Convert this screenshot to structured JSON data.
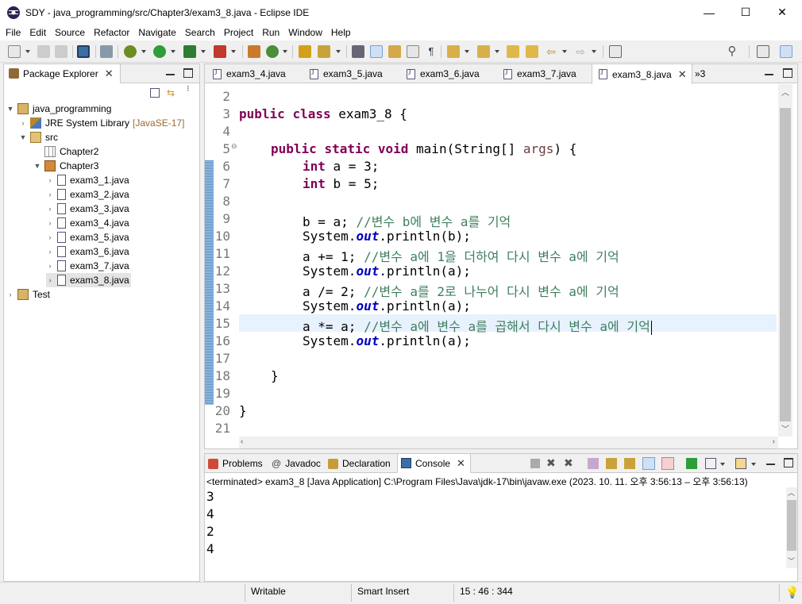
{
  "window": {
    "title": "SDY - java_programming/src/Chapter3/exam3_8.java - Eclipse IDE",
    "minimize": "—",
    "maximize": "☐",
    "close": "✕"
  },
  "menu": [
    "File",
    "Edit",
    "Source",
    "Refactor",
    "Navigate",
    "Search",
    "Project",
    "Run",
    "Window",
    "Help"
  ],
  "package_explorer": {
    "tab_label": "Package Explorer",
    "tree": {
      "project": "java_programming",
      "jre": "JRE System Library",
      "jre_decor": "[JavaSE-17]",
      "src": "src",
      "pkg_chapter2": "Chapter2",
      "pkg_chapter3": "Chapter3",
      "files": [
        "exam3_1.java",
        "exam3_2.java",
        "exam3_3.java",
        "exam3_4.java",
        "exam3_5.java",
        "exam3_6.java",
        "exam3_7.java",
        "exam3_8.java"
      ],
      "test_project": "Test"
    }
  },
  "editor": {
    "tabs": [
      "exam3_4.java",
      "exam3_5.java",
      "exam3_6.java",
      "exam3_7.java",
      "exam3_8.java"
    ],
    "active_tab": "exam3_8.java",
    "overflow": "»3",
    "line_numbers": [
      "2",
      "3",
      "4",
      "5",
      "6",
      "7",
      "8",
      "9",
      "10",
      "11",
      "12",
      "13",
      "14",
      "15",
      "16",
      "17",
      "18",
      "19",
      "20",
      "21"
    ],
    "code": {
      "l3a": "public",
      "l3b": " ",
      "l3c": "class",
      "l3d": " exam3_8 {",
      "l5a": "public",
      "l5b": "static",
      "l5c": "void",
      "l5d": " main(String[] ",
      "l5e": "args",
      "l5f": ") {",
      "l6a": "int",
      "l6b": " a = 3;",
      "l7a": "int",
      "l7b": " b = 5;",
      "l9a": "b = a; ",
      "l9b": "//변수 b에 변수 a를 기억",
      "sys": "System.",
      "out": "out",
      "println_b": ".println(b);",
      "println_a": ".println(a);",
      "l11a": "a += 1; ",
      "l11b": "//변수 a에 1을 더하여 다시 변수 a에 기억",
      "l13a": "a /= 2; ",
      "l13b": "//변수 a를 2로 나누어 다시 변수 a에 기억",
      "l15a": "a *= a; ",
      "l15b": "//변수 a에 변수 a를 곱해서 다시 변수 a에 기억",
      "l18": "}",
      "l20": "}"
    }
  },
  "console_view": {
    "tabs": [
      "Problems",
      "Javadoc",
      "Declaration",
      "Console"
    ],
    "active_tab": "Console",
    "header": "<terminated> exam3_8 [Java Application] C:\\Program Files\\Java\\jdk-17\\bin\\javaw.exe  (2023. 10. 11. 오후 3:56:13 – 오후 3:56:13)",
    "output": [
      "3",
      "4",
      "2",
      "4"
    ]
  },
  "status": {
    "mode": "Writable",
    "insert": "Smart Insert",
    "position": "15 : 46 : 344"
  },
  "colors": {
    "keyword": "#7f0055",
    "field": "#0000c0",
    "comment": "#3f7f5f",
    "line_highlight": "#e8f2fe"
  }
}
